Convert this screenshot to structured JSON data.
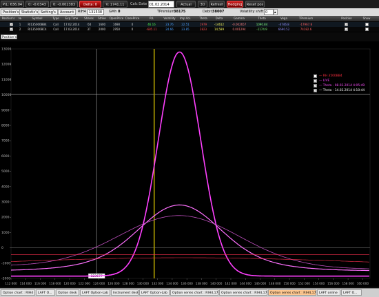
{
  "toolbar": {
    "pnl": "P/L: 636.04",
    "b2": "0: -0.0343",
    "b3": "0: -0.002383",
    "b4": "Delta: 0",
    "b5": "V: 1741.11",
    "calc_date_label": "Calc Date",
    "calc_date_value": "01.02.2014",
    "actual_price": "Actual Price",
    "btn_3d": "3D",
    "refresh": "Refresh",
    "hedging": "Hedging",
    "reset_pos": "Reset pos"
  },
  "bar2": {
    "tab_positions": "Position's",
    "tab_statistics": "Statistic's",
    "tab_settings": "Setting's",
    "tab_account": "Account",
    "instrument": "RIH4",
    "instrument_value": "131538",
    "gmh_label": "GMh",
    "gmh_value": "0",
    "tpremium_label": "TPremium:",
    "tpremium_value": "38175",
    "debit_label": "Debit:",
    "debit_value": "38007",
    "vol_label": "Volatility shift:",
    "vol_value": "0"
  },
  "table": {
    "headers": [
      "Position's",
      "№",
      "Symbol",
      "Type",
      "Exp.Time",
      "Shares",
      "Strike",
      "OpenPrice",
      "ClosePrice",
      "P/L",
      "Volatility",
      "Imp.Vol.",
      "Theta",
      "Delta",
      "Gamma",
      "Theta",
      "Vega",
      "TPremium",
      "Position",
      "Show"
    ],
    "rows": [
      {
        "num": "1",
        "symbol": "RI135000BB4",
        "type": "Call",
        "exp": "17.02.2014",
        "shares": "-50",
        "strike": "1600",
        "open": "1690",
        "close": "0",
        "pl": "46.16",
        "vol": "23.76",
        "impvol": "22.51",
        "theta": "1979",
        "delta": "-14612",
        "gamma": "-0.002657",
        "theta2": "1090.84",
        "vega": "-4746.8",
        "tprem": "-17967.8"
      },
      {
        "num": "2",
        "symbol": "RI135000BC4",
        "type": "Call",
        "exp": "17.03.2014",
        "shares": "37",
        "strike": "2000",
        "open": "2950",
        "close": "0",
        "pl": "-685.11",
        "vol": "24.66",
        "impvol": "23.85",
        "theta": "2823",
        "delta": "14,589",
        "gamma": "0.001294",
        "theta2": "-1174.9",
        "vega": "6690.52",
        "tprem": "74182.6"
      }
    ]
  },
  "filter": {
    "value": "1002.8"
  },
  "legend": {
    "items": [
      {
        "label": "RH 3500BB4",
        "color": "#ff3040"
      },
      {
        "label": "LIVE",
        "color": "#ff40ff"
      },
      {
        "label": "Theta - 08.02.2014 4:05:49",
        "color": "#ff50ff"
      },
      {
        "label": "Theta - 14.02.2014 4:10:44",
        "color": "#ffffff"
      }
    ]
  },
  "chart_data": {
    "type": "line",
    "y_ticks": [
      "13000",
      "12000",
      "11000",
      "10000",
      "9000",
      "8000",
      "7000",
      "6000",
      "5000",
      "4000",
      "3000",
      "2000",
      "1000",
      "0",
      "-1000",
      "-2000"
    ],
    "x_ticks": [
      "112 000",
      "114 000",
      "116 000",
      "118 000",
      "120 000",
      "122 000",
      "124 000",
      "126 000",
      "128 000",
      "130 000",
      "132 000",
      "134 000",
      "136 000",
      "138 000",
      "140 000",
      "142 000",
      "144 000",
      "146 000",
      "148 000",
      "150 000",
      "152 000",
      "154 000",
      "156 000",
      "158 000",
      "160 000"
    ],
    "ylim": [
      -2000,
      13000
    ],
    "xlim": [
      112000,
      161000
    ],
    "cursor_x_label": "123677",
    "cursor_y_label": "10022.8",
    "spot": 131538,
    "grid": false
  },
  "taskbar": {
    "items": [
      "Option chart : RIH4 online",
      "LAFT O...",
      "Option desk",
      "LAFT Option-Lab",
      "Instrument desk",
      "LAFT Option-Lab",
      "Option series chart : RIH4,17.02.2014 - ...",
      "Option series chart : RIH4,17.03.2014 - ...",
      "Option series chart : RIH4,17.02.2014 - ...",
      "LAFT online",
      "LAFT O..."
    ]
  }
}
